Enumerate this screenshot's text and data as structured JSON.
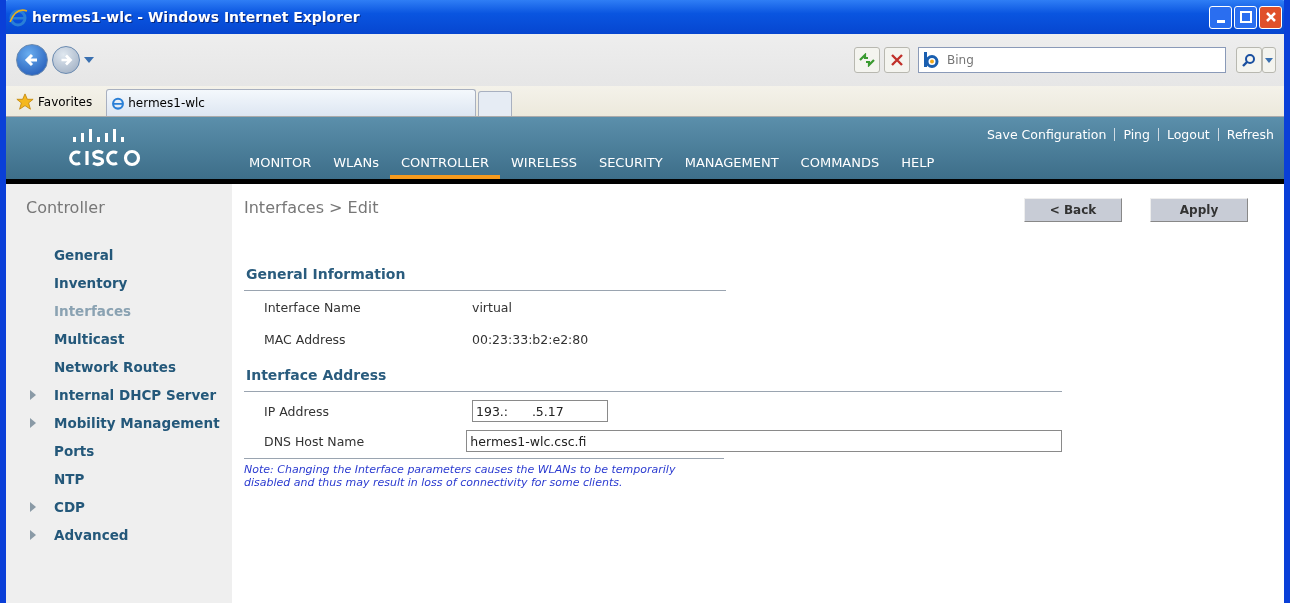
{
  "window": {
    "title": "hermes1-wlc - Windows Internet Explorer"
  },
  "search": {
    "placeholder": "Bing"
  },
  "favorites": {
    "label": "Favorites"
  },
  "tabs": [
    {
      "label": "hermes1-wlc",
      "selected": true
    }
  ],
  "header": {
    "links": [
      "Save Configuration",
      "Ping",
      "Logout",
      "Refresh"
    ],
    "nav": [
      {
        "label": "MONITOR",
        "selected": false
      },
      {
        "label": "WLANs",
        "selected": false
      },
      {
        "label": "CONTROLLER",
        "selected": true
      },
      {
        "label": "WIRELESS",
        "selected": false
      },
      {
        "label": "SECURITY",
        "selected": false
      },
      {
        "label": "MANAGEMENT",
        "selected": false
      },
      {
        "label": "COMMANDS",
        "selected": false
      },
      {
        "label": "HELP",
        "selected": false
      }
    ]
  },
  "sidebar": {
    "title": "Controller",
    "items": [
      {
        "label": "General",
        "kind": "link",
        "selected": false
      },
      {
        "label": "Inventory",
        "kind": "link",
        "selected": false
      },
      {
        "label": "Interfaces",
        "kind": "link",
        "selected": true
      },
      {
        "label": "Multicast",
        "kind": "link",
        "selected": false
      },
      {
        "label": "Network Routes",
        "kind": "link",
        "selected": false
      },
      {
        "label": "Internal DHCP Server",
        "kind": "folder",
        "selected": false
      },
      {
        "label": "Mobility Management",
        "kind": "folder",
        "selected": false
      },
      {
        "label": "Ports",
        "kind": "link",
        "selected": false
      },
      {
        "label": "NTP",
        "kind": "link",
        "selected": false
      },
      {
        "label": "CDP",
        "kind": "folder",
        "selected": false
      },
      {
        "label": "Advanced",
        "kind": "folder",
        "selected": false
      }
    ]
  },
  "page": {
    "title": "Interfaces > Edit",
    "buttons": [
      "< Back",
      "Apply"
    ],
    "general": {
      "heading": "General Information",
      "rows": [
        {
          "label": "Interface Name",
          "value": "virtual"
        },
        {
          "label": "MAC Address",
          "value": "00:23:33:b2:e2:80"
        }
      ]
    },
    "address": {
      "heading": "Interface Address",
      "fields": [
        {
          "label": "IP Address",
          "value": "193.:      .5.17",
          "kind": "short"
        },
        {
          "label": "DNS Host Name",
          "value": "hermes1-wlc.csc.fi",
          "kind": "long"
        }
      ]
    },
    "note": "Note: Changing the Interface parameters causes the WLANs to be temporarily disabled and thus may result in loss of connectivity for some clients."
  }
}
